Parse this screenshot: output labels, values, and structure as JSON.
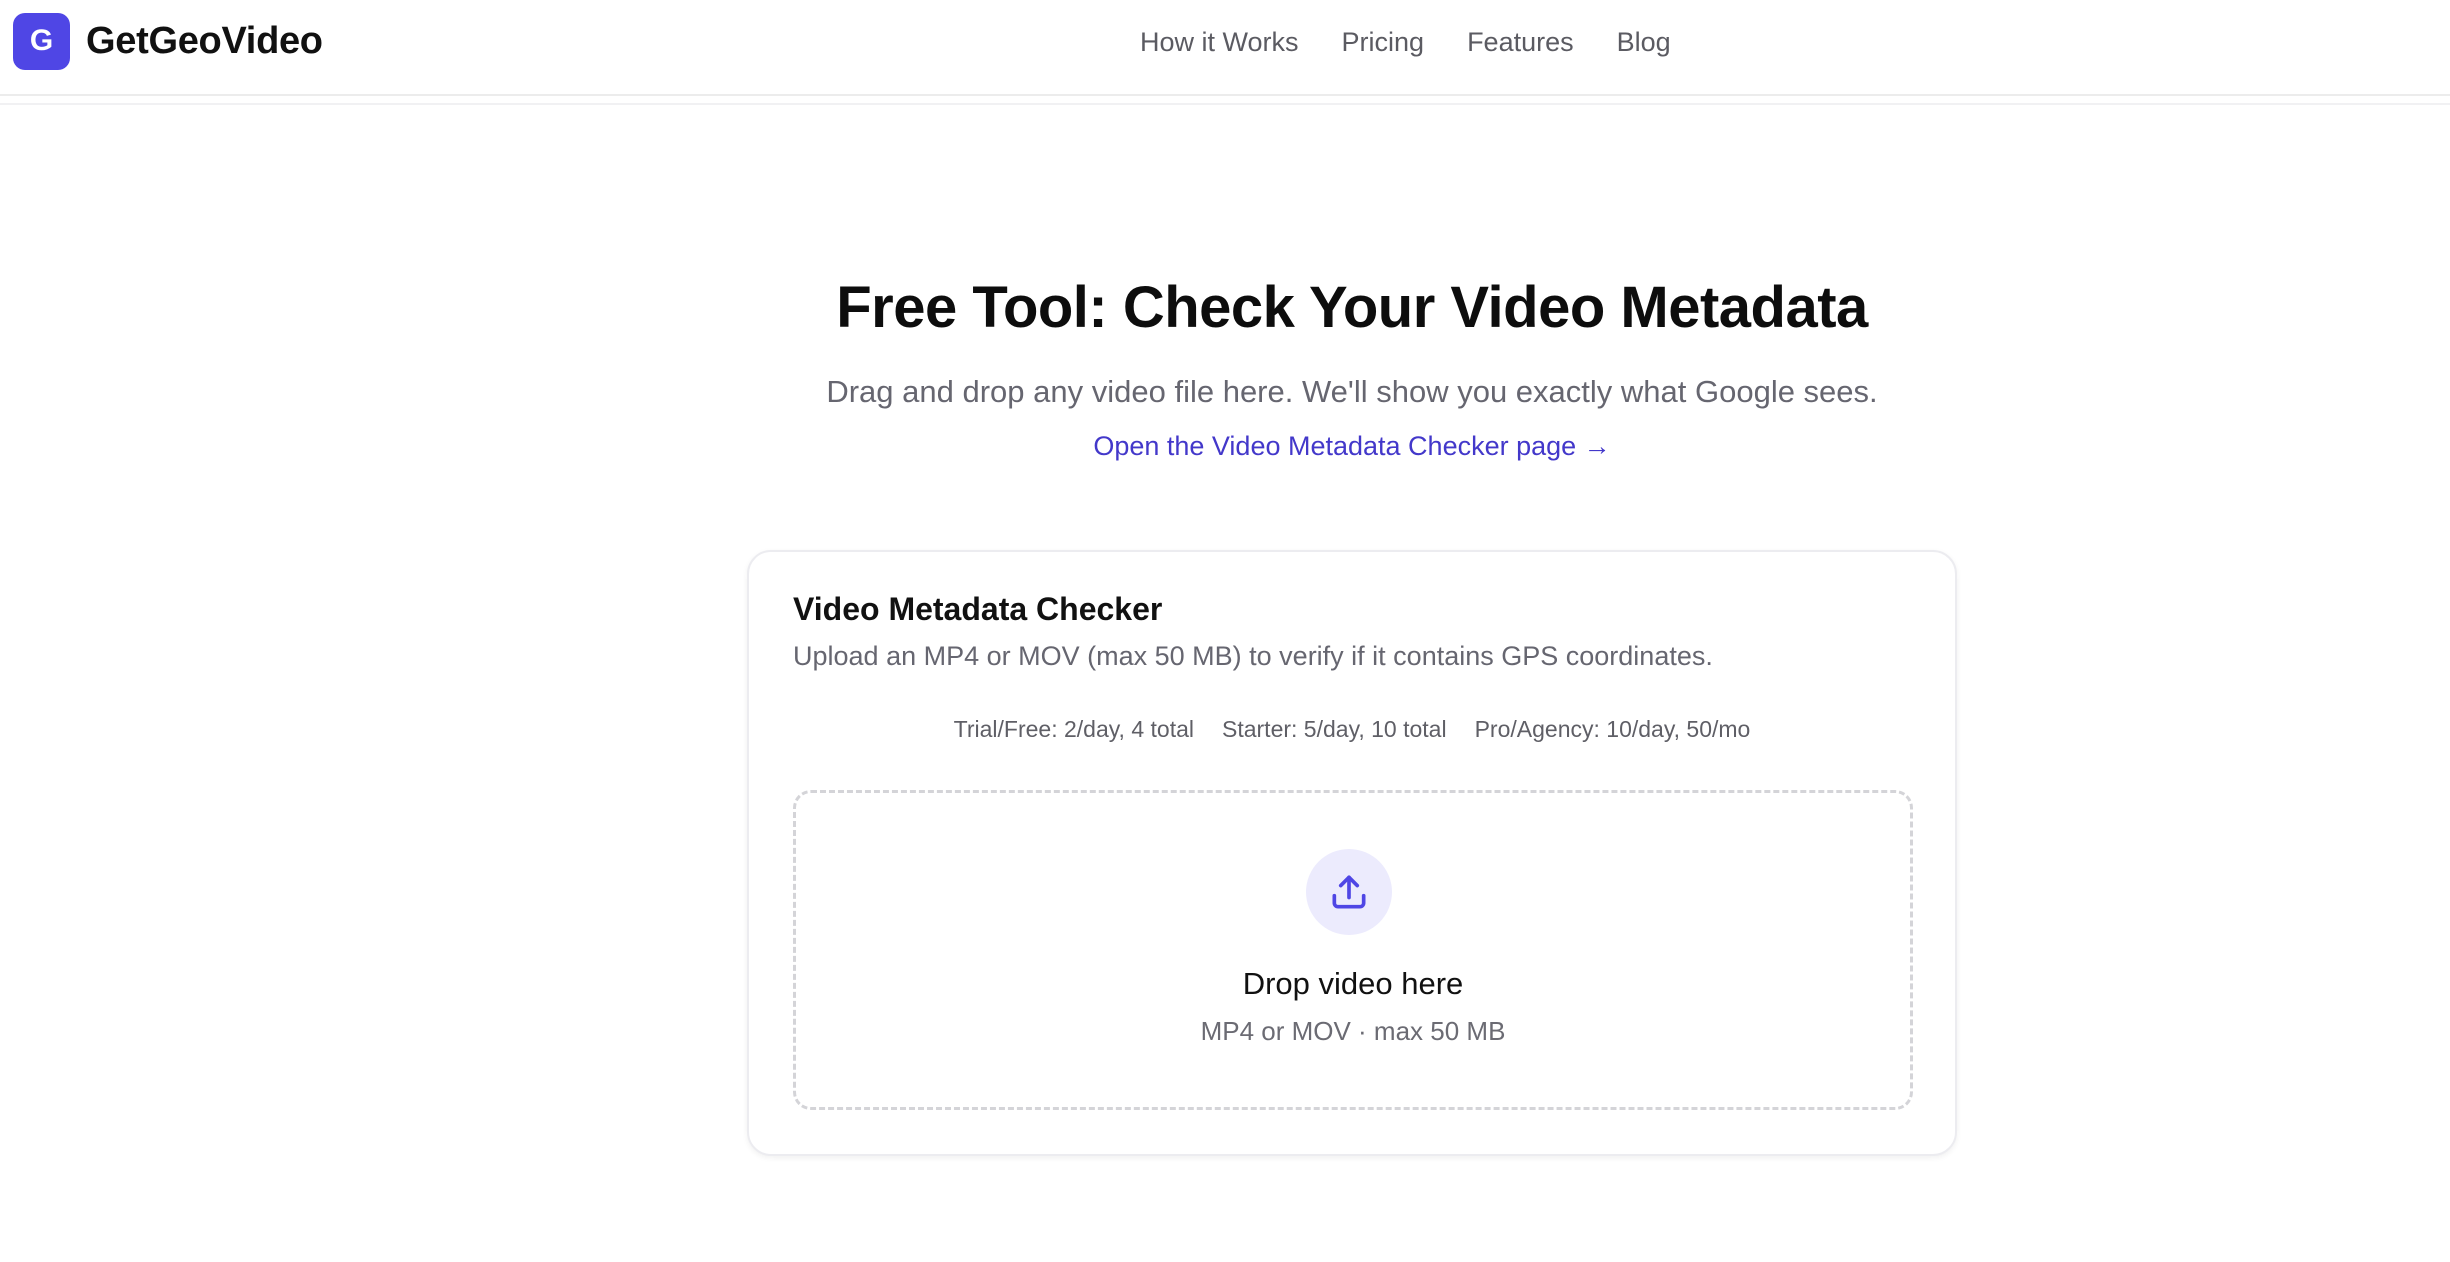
{
  "brand": {
    "logo_letter": "G",
    "name": "GetGeoVideo",
    "logo_color": "#4f46e5"
  },
  "nav": {
    "items": [
      {
        "label": "How it Works"
      },
      {
        "label": "Pricing"
      },
      {
        "label": "Features"
      },
      {
        "label": "Blog"
      }
    ]
  },
  "hero": {
    "title": "Free Tool: Check Your Video Metadata",
    "subtitle": "Drag and drop any video file here. We'll show you exactly what Google sees.",
    "link_text": "Open the Video Metadata Checker page →",
    "link_color": "#4338ca"
  },
  "checker": {
    "title": "Video Metadata Checker",
    "description": "Upload an MP4 or MOV (max 50 MB) to verify if it contains GPS coordinates.",
    "quotas": [
      "Trial/Free: 2/day, 4 total",
      "Starter: 5/day, 10 total",
      "Pro/Agency: 10/day, 50/mo"
    ],
    "dropzone": {
      "icon": "upload-icon",
      "title": "Drop video here",
      "hint": "MP4 or MOV · max 50 MB"
    }
  }
}
